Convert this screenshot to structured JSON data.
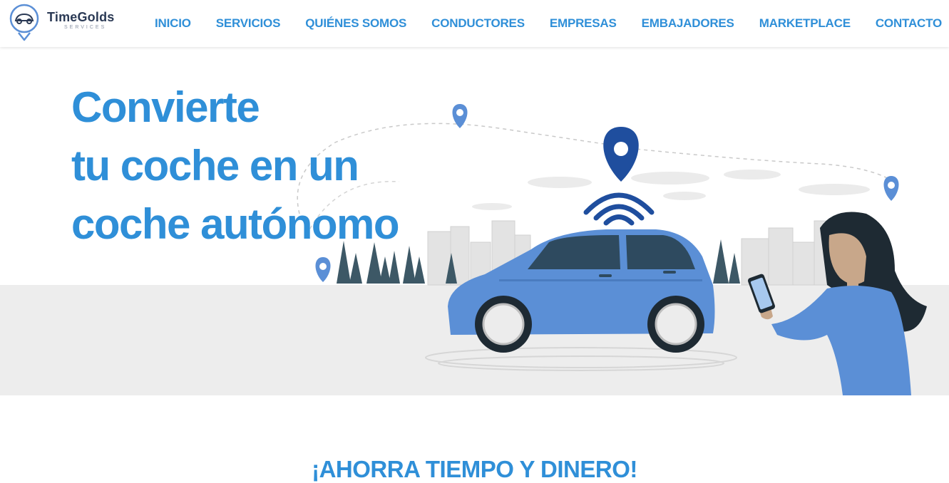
{
  "brand": {
    "name": "TimeGolds",
    "subtitle": "SERVICES"
  },
  "nav": {
    "items": [
      {
        "label": "INICIO"
      },
      {
        "label": "SERVICIOS"
      },
      {
        "label": "QUIÉNES SOMOS"
      },
      {
        "label": "CONDUCTORES"
      },
      {
        "label": "EMPRESAS"
      },
      {
        "label": "EMBAJADORES"
      },
      {
        "label": "MARKETPLACE"
      },
      {
        "label": "CONTACTO"
      }
    ]
  },
  "hero": {
    "headline": [
      "Convierte",
      "tu coche en un",
      "coche autónomo"
    ],
    "illustration_icons": [
      "location-pin-icon",
      "wifi-signal-icon",
      "car-icon",
      "smartphone-icon"
    ]
  },
  "section": {
    "title": "¡AHORRA TIEMPO Y DINERO!"
  },
  "colors": {
    "accent": "#2f8fd8",
    "brand_dark": "#2b3a55",
    "car_blue": "#5b8fd6",
    "pin_dark": "#1f4e9e",
    "ground": "#ededed"
  }
}
